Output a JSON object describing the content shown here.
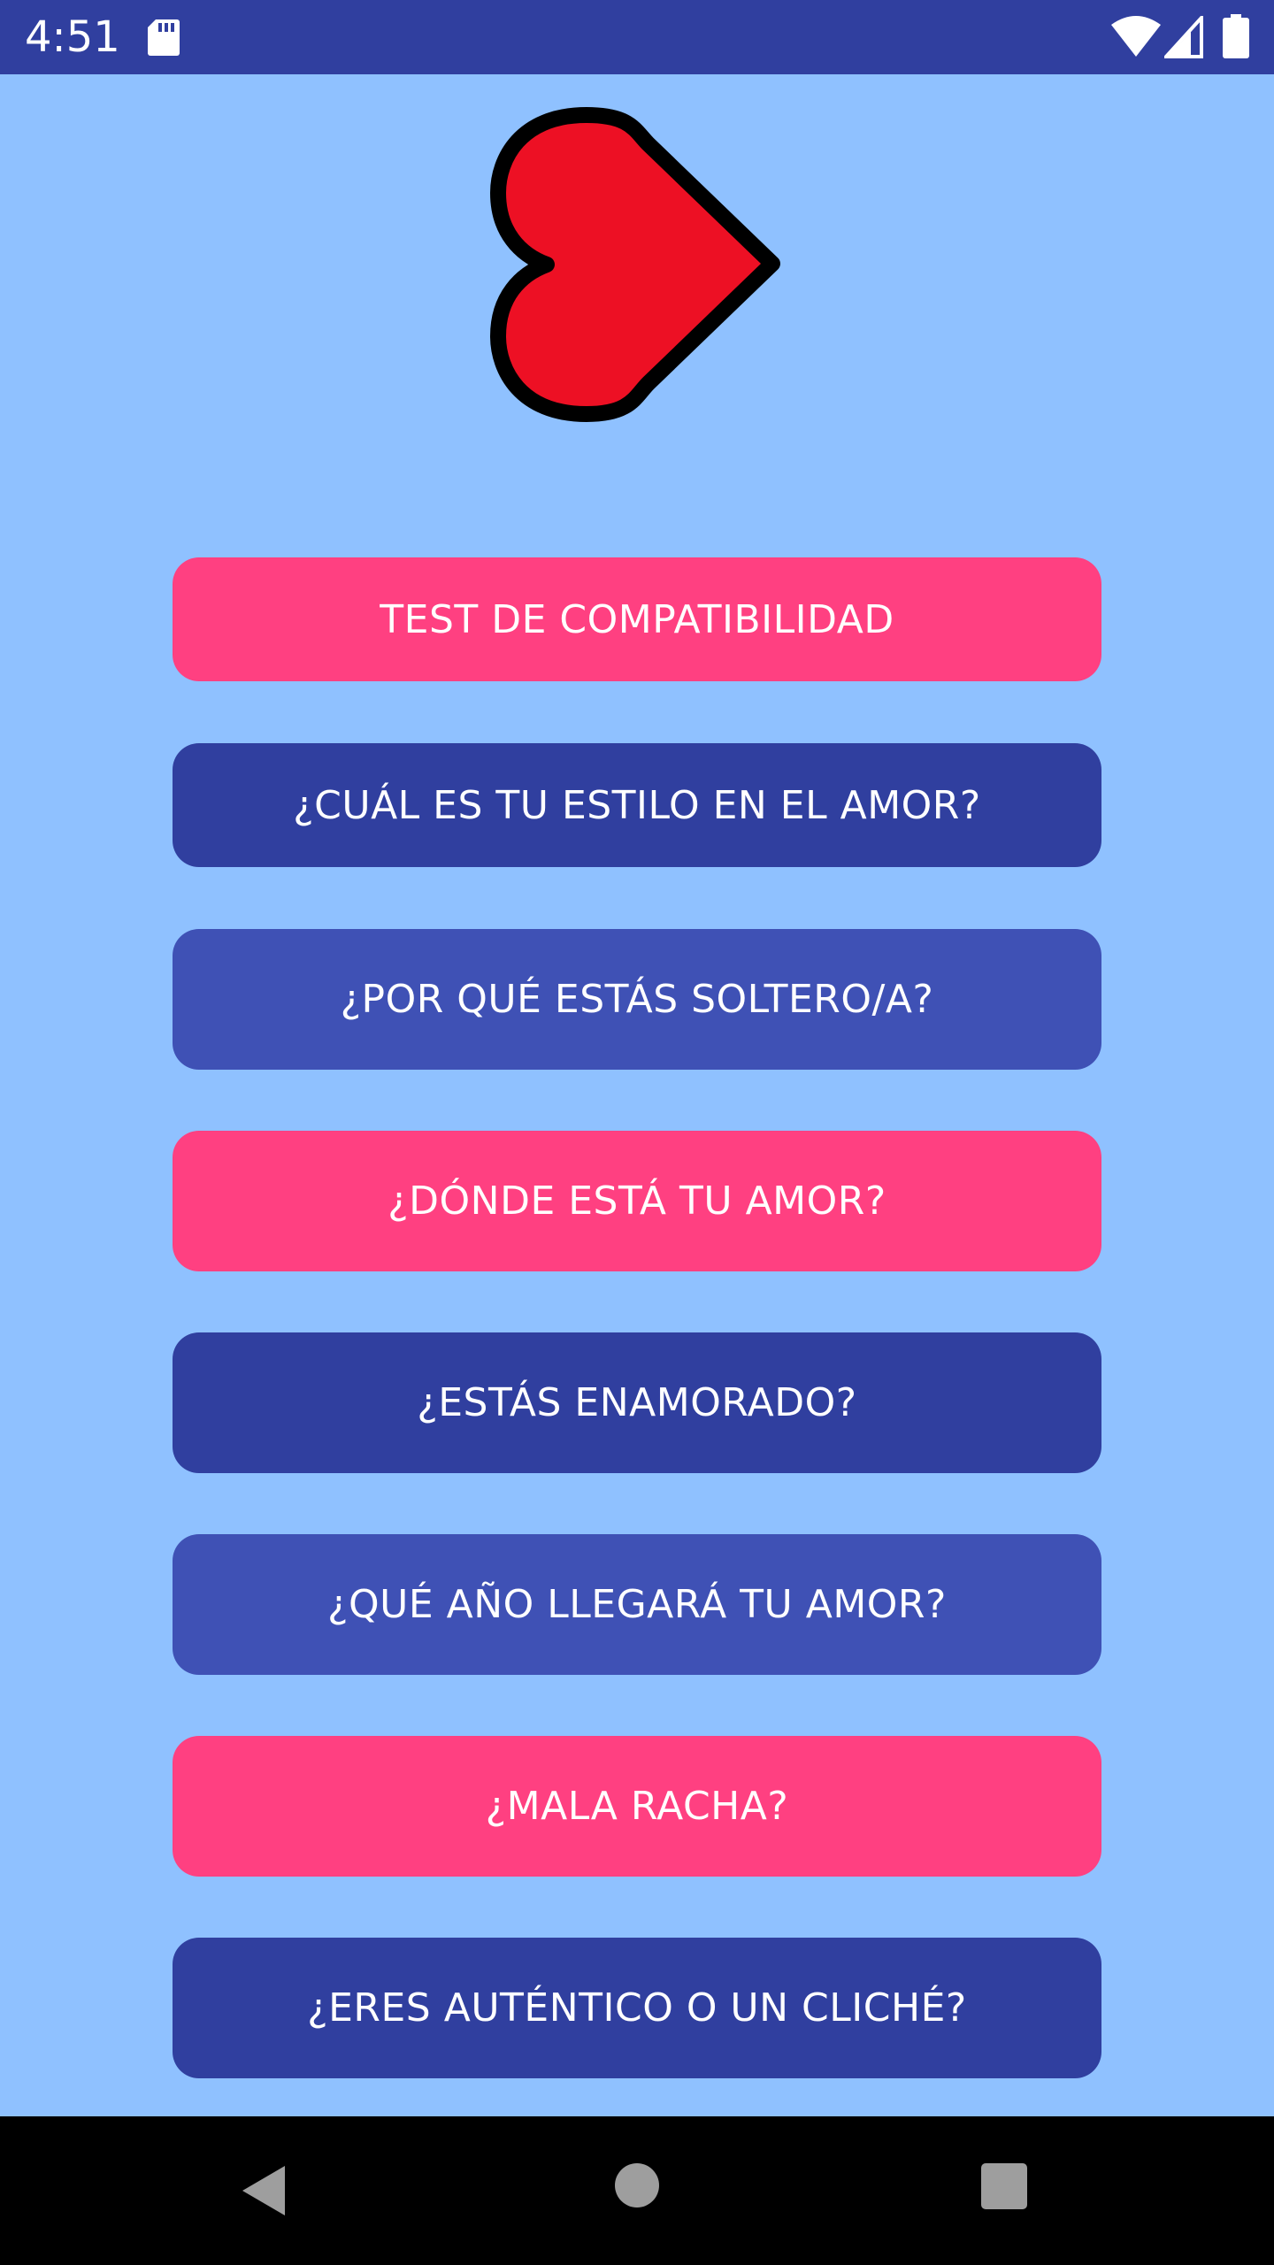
{
  "status_bar": {
    "time": "4:51",
    "background": "#303f9f",
    "icons": [
      "sd-card-icon",
      "wifi-icon",
      "signal-icon",
      "battery-icon"
    ]
  },
  "logo": {
    "icon": "heart-icon",
    "fill": "#ed1024",
    "stroke": "#000000"
  },
  "background_color": "#8fc1ff",
  "menu": {
    "buttons": [
      {
        "label": "TEST DE COMPATIBILIDAD",
        "color": "#ff4081"
      },
      {
        "label": "¿CUÁL ES TU ESTILO EN EL AMOR?",
        "color": "#303f9f"
      },
      {
        "label": "¿POR QUÉ ESTÁS SOLTERO/A?",
        "color": "#3f51b5"
      },
      {
        "label": "¿DÓNDE ESTÁ TU AMOR?",
        "color": "#ff4081"
      },
      {
        "label": "¿ESTÁS ENAMORADO?",
        "color": "#303f9f"
      },
      {
        "label": "¿QUÉ AÑO LLEGARÁ TU AMOR?",
        "color": "#3f51b5"
      },
      {
        "label": "¿MALA RACHA?",
        "color": "#ff4081"
      },
      {
        "label": "¿ERES AUTÉNTICO O UN CLICHÉ?",
        "color": "#303f9f"
      }
    ]
  },
  "nav_bar": {
    "icons": [
      "back-icon",
      "home-icon",
      "recents-icon"
    ]
  }
}
